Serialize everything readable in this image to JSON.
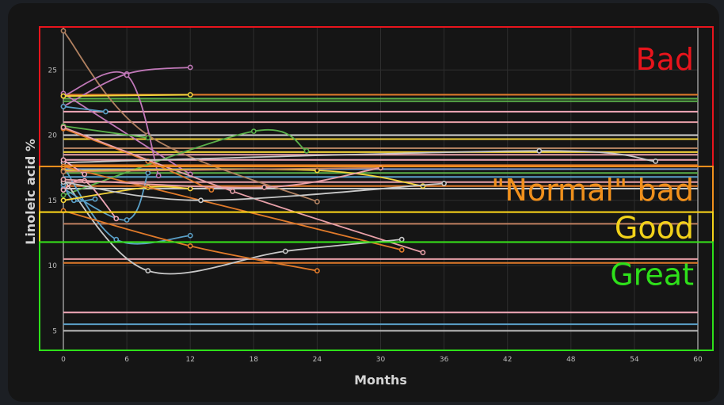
{
  "chart_data": {
    "type": "line",
    "title": "",
    "xlabel": "Months",
    "ylabel": "Linoleic acid %",
    "xlim": [
      0,
      60
    ],
    "ylim": [
      3.5,
      28.3
    ],
    "xticks": [
      0,
      6,
      12,
      18,
      24,
      30,
      36,
      42,
      48,
      54,
      60
    ],
    "yticks": [
      5,
      10,
      15,
      20,
      25
    ],
    "grid": true,
    "zones": [
      {
        "label": "Bad",
        "color": "#e8141c",
        "y_from": 17.6,
        "y_to": 28.3
      },
      {
        "label": "\"Normal\" bad",
        "color": "#f0901c",
        "y_from": 14.1,
        "y_to": 17.6
      },
      {
        "label": "Good",
        "color": "#f2d21a",
        "y_from": 11.8,
        "y_to": 14.1
      },
      {
        "label": "Great",
        "color": "#2ee01a",
        "y_from": 3.5,
        "y_to": 11.8
      }
    ],
    "hlines": [
      {
        "y": 23.1,
        "color": "#e07a2a"
      },
      {
        "y": 22.8,
        "color": "#5ab04a"
      },
      {
        "y": 22.6,
        "color": "#5ab04a"
      },
      {
        "y": 21.8,
        "color": "#f0a8b8"
      },
      {
        "y": 21.0,
        "color": "#e8a0a8"
      },
      {
        "y": 20.0,
        "color": "#d4d4d4"
      },
      {
        "y": 19.7,
        "color": "#f4d43a"
      },
      {
        "y": 19.0,
        "color": "#b08060"
      },
      {
        "y": 18.7,
        "color": "#f4d43a"
      },
      {
        "y": 18.5,
        "color": "#e8a0a8"
      },
      {
        "y": 18.1,
        "color": "#f0a8b8"
      },
      {
        "y": 17.7,
        "color": "#e07a2a"
      },
      {
        "y": 17.4,
        "color": "#7a9ad0"
      },
      {
        "y": 17.1,
        "color": "#5ab04a"
      },
      {
        "y": 16.8,
        "color": "#5aa0c8"
      },
      {
        "y": 16.4,
        "color": "#e8a0a8"
      },
      {
        "y": 16.1,
        "color": "#e07a2a"
      },
      {
        "y": 15.9,
        "color": "#c8c8c8"
      },
      {
        "y": 13.2,
        "color": "#c08060"
      },
      {
        "y": 10.5,
        "color": "#e8a0a8"
      },
      {
        "y": 10.2,
        "color": "#e07a2a"
      },
      {
        "y": 6.4,
        "color": "#f0a8b8"
      },
      {
        "y": 5.5,
        "color": "#5aa0c8"
      },
      {
        "y": 5.0,
        "color": "#bdbdbd"
      }
    ],
    "series": [
      {
        "color": "#b08060",
        "x": [
          0,
          8,
          24
        ],
        "y": [
          28.0,
          20.0,
          14.9
        ]
      },
      {
        "color": "#c078b8",
        "x": [
          0,
          6,
          12
        ],
        "y": [
          22.2,
          24.7,
          25.2
        ]
      },
      {
        "color": "#c078b8",
        "x": [
          0,
          6,
          9
        ],
        "y": [
          23.0,
          24.6,
          16.9
        ]
      },
      {
        "color": "#c078b8",
        "x": [
          0,
          12
        ],
        "y": [
          23.2,
          17.0
        ]
      },
      {
        "color": "#f4d43a",
        "x": [
          0,
          12
        ],
        "y": [
          23.0,
          23.1
        ]
      },
      {
        "color": "#5aa0c8",
        "x": [
          0,
          4
        ],
        "y": [
          22.2,
          21.8
        ]
      },
      {
        "color": "#5ab04a",
        "x": [
          0,
          8
        ],
        "y": [
          20.7,
          19.8
        ]
      },
      {
        "color": "#5ab04a",
        "x": [
          0,
          18,
          23
        ],
        "y": [
          15.4,
          20.3,
          18.8
        ]
      },
      {
        "color": "#e07a2a",
        "x": [
          0,
          8,
          14
        ],
        "y": [
          20.5,
          18.0,
          15.8
        ]
      },
      {
        "color": "#e8a0a8",
        "x": [
          0,
          16,
          34
        ],
        "y": [
          20.6,
          15.7,
          11.0
        ]
      },
      {
        "color": "#c8c8c8",
        "x": [
          0,
          45,
          56
        ],
        "y": [
          17.9,
          18.8,
          18.0
        ]
      },
      {
        "color": "#c8c8c8",
        "x": [
          0,
          8,
          21,
          32
        ],
        "y": [
          16.6,
          9.6,
          11.1,
          12.0
        ]
      },
      {
        "color": "#5aa0c8",
        "x": [
          0,
          5,
          12
        ],
        "y": [
          17.6,
          12.0,
          12.3
        ]
      },
      {
        "color": "#5aa0c8",
        "x": [
          0,
          1,
          3
        ],
        "y": [
          16.2,
          15.0,
          15.1
        ]
      },
      {
        "color": "#5aa0c8",
        "x": [
          0,
          6,
          8
        ],
        "y": [
          15.9,
          13.5,
          17.1
        ]
      },
      {
        "color": "#f4d43a",
        "x": [
          0,
          24,
          34
        ],
        "y": [
          17.3,
          17.3,
          16.1
        ]
      },
      {
        "color": "#f4d43a",
        "x": [
          0,
          8,
          12
        ],
        "y": [
          15.0,
          16.0,
          15.9
        ]
      },
      {
        "color": "#e07a2a",
        "x": [
          0,
          12,
          24
        ],
        "y": [
          14.2,
          11.5,
          9.6
        ]
      },
      {
        "color": "#e07a2a",
        "x": [
          0,
          32
        ],
        "y": [
          17.6,
          11.2
        ]
      },
      {
        "color": "#f0a8b8",
        "x": [
          0,
          2,
          5
        ],
        "y": [
          15.8,
          16.5,
          13.6
        ]
      },
      {
        "color": "#f0a8b8",
        "x": [
          0,
          2
        ],
        "y": [
          18.1,
          17.0
        ]
      },
      {
        "color": "#c8c8c8",
        "x": [
          0,
          13,
          36
        ],
        "y": [
          16.4,
          15.0,
          16.3
        ]
      },
      {
        "color": "#c08060",
        "x": [
          0,
          30
        ],
        "y": [
          17.2,
          17.5
        ]
      },
      {
        "color": "#e8a0a8",
        "x": [
          0,
          19,
          30
        ],
        "y": [
          16.6,
          16.0,
          17.5
        ]
      }
    ]
  }
}
